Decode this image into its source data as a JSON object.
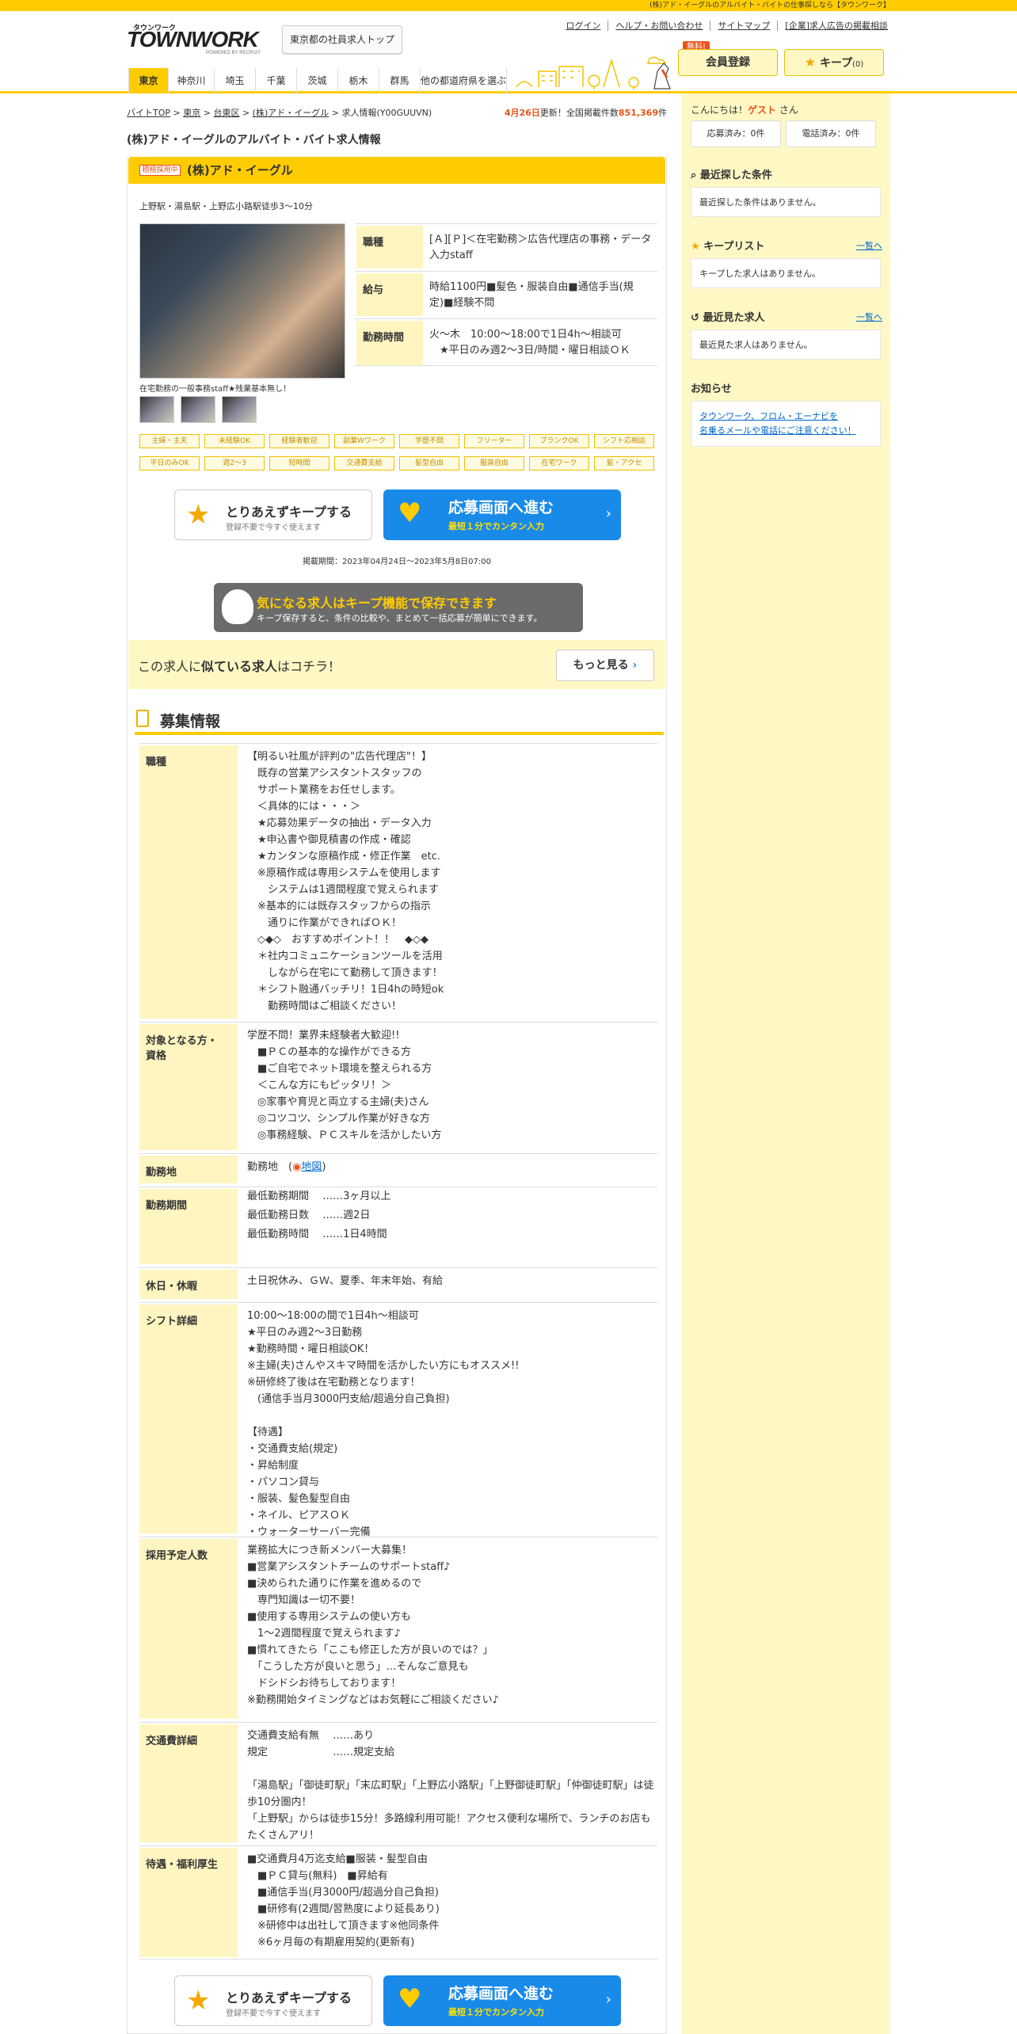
{
  "topbar": {
    "text": "(株)アド・イーグルのアルバイト・バイトの仕事探しなら【タウンワーク】"
  },
  "logo": {
    "kana": "タウンワーク",
    "name": "TOWNWORK",
    "powered": "POWERED BY RECRUIT"
  },
  "header": {
    "tokyo_top": "東京都の社員求人トップ",
    "links": [
      "ログイン",
      "ヘルプ・お問い合わせ",
      "サイトマップ",
      "[企業]求人広告の掲載相談"
    ],
    "free_badge": "無料!",
    "member": "会員登録",
    "keep": "キープ",
    "keep_count": "(0)"
  },
  "nav": {
    "tabs": [
      "東京",
      "神奈川",
      "埼玉",
      "千葉",
      "茨城",
      "栃木",
      "群馬",
      "他の都道府県を選ぶ"
    ]
  },
  "breadcrumb": [
    "バイトTOP",
    "東京",
    "台東区",
    "(株)アド・イーグル",
    "求人情報(Y00GUUVN)"
  ],
  "updated": {
    "date": "4月26日",
    "mid": "更新！全国掲載件数",
    "count": "851,369",
    "unit": "件"
  },
  "page_title": "(株)アド・イーグルのアルバイト・バイト求人情報",
  "company": {
    "tag": "積極採用中",
    "name": "(株)アド・イーグル"
  },
  "access": "上野駅・湯島駅・上野広小路駅徒歩3～10分",
  "photo_caption": "在宅勤務の一般事務staff★残業基本無し！",
  "info": [
    {
      "k": "職種",
      "v": "[Ａ][Ｐ]＜在宅勤務＞広告代理店の事務・データ入力staff"
    },
    {
      "k": "給与",
      "v": "時給1100円■髪色・服装自由■通信手当(規定)■経験不問"
    },
    {
      "k": "勤務時間",
      "v": "火～木　10:00～18:00で1日4h～相談可\n　★平日のみ週2～3日/時間・曜日相談ＯＫ"
    }
  ],
  "tags": [
    "主婦・主夫",
    "未経験OK",
    "経験者歓迎",
    "副業Wワーク",
    "学歴不問",
    "フリーター",
    "ブランクOK",
    "シフト応相談",
    "平日のみOK",
    "週2～3",
    "短時間",
    "交通費支給",
    "髪型自由",
    "服装自由",
    "在宅ワーク",
    "髪・アクセ"
  ],
  "buttons": {
    "keep_l1": "とりあえずキープする",
    "keep_l2": "登録不要で今すぐ使えます",
    "apply_l1": "応募画面へ進む",
    "apply_l2": "最短１分でカンタン入力"
  },
  "period": "掲載期間：2023年04月24日～2023年5月8日07:00",
  "keep_banner": {
    "l1": "気になる求人はキープ機能で保存できます",
    "l2": "キープ保存すると、条件の比較や、まとめて一括応募が簡単にできます。"
  },
  "similar": {
    "pre": "この求人に",
    "bold": "似ている求人",
    "post": "はコチラ！",
    "btn": "もっと見る"
  },
  "section_title": "募集情報",
  "rows": [
    {
      "k": "職種",
      "v": "【明るい社風が評判の\"広告代理店\"！】\n　既存の営業アシスタントスタッフの\n　サポート業務をお任せします。\n　＜具体的には・・・＞\n　★応募効果データの抽出・データ入力\n　★申込書や御見積書の作成・確認\n　★カンタンな原稿作成・修正作業　etc.\n　※原稿作成は専用システムを使用します\n　　システムは1週間程度で覚えられます\n　※基本的には既存スタッフからの指示\n　　通りに作業ができればＯＫ！\n　◇◆◇　おすすめポイント！！　◆◇◆\n　＊社内コミュニケーションツールを活用\n　　しながら在宅にて勤務して頂きます！\n　＊シフト融通バッチリ！1日4hの時短ok\n　　勤務時間はご相談ください！"
    },
    {
      "k": "対象となる方・\n資格",
      "v": "学歴不問！業界未経験者大歓迎!!\n　■ＰＣの基本的な操作ができる方\n　■ご自宅でネット環境を整えられる方\n　＜こんな方にもピッタリ！＞\n　◎家事や育児と両立する主婦(夫)さん\n　◎コツコツ、シンプル作業が好きな方\n　◎事務経験、ＰＣスキルを活かしたい方"
    },
    {
      "k": "勤務地",
      "v": "勤務地　(",
      "map": "地図",
      "close": ")"
    },
    {
      "k": "勤務期間",
      "v": "最低勤務期間　 ……3ヶ月以上\n\n最低勤務日数　 ……週2日\n\n最低勤務時間　 ……1日4時間"
    },
    {
      "k": "休日・休暇",
      "v": "土日祝休み、ＧＷ、夏季、年末年始、有給"
    },
    {
      "k": "シフト詳細",
      "v": "10:00～18:00の間で1日4h～相談可\n★平日のみ週2～3日勤務\n★勤務時間・曜日相談OK！\n※主婦(夫)さんやスキマ時間を活かしたい方にもオススメ!!\n※研修終了後は在宅勤務となります！\n　(通信手当月3000円支給/超過分自己負担)\n\n【待遇】\n・交通費支給(規定)\n・昇給制度\n・パソコン貸与\n・服装、髪色髪型自由\n・ネイル、ピアスＯＫ\n・ウォーターサーバー完備"
    },
    {
      "k": "採用予定人数",
      "v": "業務拡大につき新メンバー大募集！\n■営業アシスタントチームのサポートstaff♪\n■決められた通りに作業を進めるので\n　専門知識は一切不要！\n■使用する専用システムの使い方も\n　1～2週間程度で覚えられます♪\n■慣れてきたら「ここも修正した方が良いのでは？」\n　「こうした方が良いと思う」…そんなご意見も\n　ドシドシお待ちしております！\n※勤務開始タイミングなどはお気軽にご相談ください♪"
    },
    {
      "k": "交通費詳細",
      "v": "交通費支給有無　 ……あり\n規定　　　　　　 ……規定支給\n\n「湯島駅」「御徒町駅」「末広町駅」「上野広小路駅」「上野御徒町駅」「仲御徒町駅」は徒歩10分圏内！\n「上野駅」からは徒歩15分！多路線利用可能！アクセス便利な場所で、ランチのお店もたくさんアリ！"
    },
    {
      "k": "待遇・福利厚生",
      "v": "■交通費月4万迄支給■服装・髪型自由\n　■ＰＣ貸与(無料)　■昇給有\n　■通信手当(月3000円/超過分自己負担)\n　■研修有(2週間/習熟度により延長あり)\n　※研修中は出社して頂きます※他同条件\n　※6ヶ月毎の有期雇用契約(更新有)"
    }
  ],
  "sidebar": {
    "greet_pre": "こんにちは！",
    "guest": "ゲスト",
    "greet_post": "さん",
    "applied": "応募済み：0件",
    "called": "電話済み：0件",
    "recent_cond_h": "最近探した条件",
    "recent_cond": "最近探した条件はありません。",
    "keeplist_h": "キープリスト",
    "keeplist": "キープした求人はありません。",
    "recent_seen_h": "最近見た求人",
    "recent_seen": "最近見た求人はありません。",
    "more": "一覧へ",
    "notice_h": "お知らせ",
    "notice_l1": "タウンワーク、フロム・エーナビを",
    "notice_l2": "名乗るメールや電話にご注意ください！"
  },
  "colors": {
    "accent": "#ffcc00",
    "orange": "#e9531a",
    "apply_blue": "#1a8ae8",
    "pale_yellow": "#fff8c4"
  }
}
